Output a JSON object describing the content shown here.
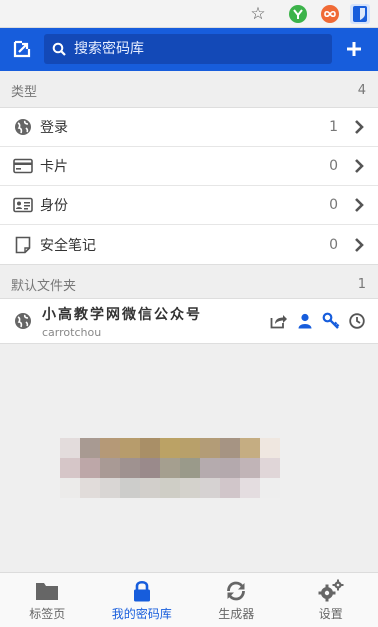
{
  "colors": {
    "brand": "#175ddc",
    "active": "#175ddc"
  },
  "search": {
    "placeholder": "搜索密码库"
  },
  "types_section": {
    "title": "类型",
    "count": "4",
    "items": [
      {
        "label": "登录",
        "count": "1",
        "icon": "globe-icon"
      },
      {
        "label": "卡片",
        "count": "0",
        "icon": "credit-card-icon"
      },
      {
        "label": "身份",
        "count": "0",
        "icon": "id-card-icon"
      },
      {
        "label": "安全笔记",
        "count": "0",
        "icon": "note-icon"
      }
    ]
  },
  "folders_section": {
    "title": "默认文件夹",
    "count": "1",
    "items": [
      {
        "name": "小高教学网微信公众号",
        "username": "carrotchou"
      }
    ]
  },
  "bottom_nav": {
    "items": [
      {
        "label": "标签页",
        "icon": "folder-icon"
      },
      {
        "label": "我的密码库",
        "icon": "lock-icon",
        "active": true
      },
      {
        "label": "生成器",
        "icon": "refresh-icon"
      },
      {
        "label": "设置",
        "icon": "gears-icon"
      }
    ]
  }
}
